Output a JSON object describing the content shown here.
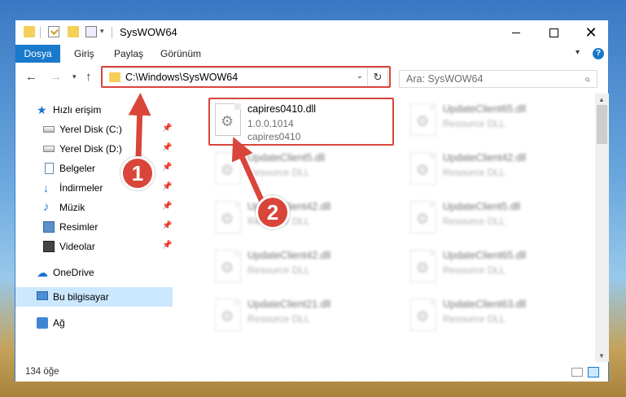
{
  "window": {
    "title": "SysWOW64",
    "minimize_icon": "minimize-icon",
    "maximize_icon": "maximize-icon",
    "close_label": "✕"
  },
  "ribbon": {
    "tabs": [
      {
        "label": "Dosya",
        "active": true
      },
      {
        "label": "Giriş"
      },
      {
        "label": "Paylaş"
      },
      {
        "label": "Görünüm"
      }
    ],
    "help_label": "?"
  },
  "nav": {
    "back_label": "←",
    "forward_label": "→",
    "recent_label": "▾",
    "up_label": "↑",
    "address": "C:\\Windows\\SysWOW64",
    "refresh_label": "↻",
    "search_placeholder": "Ara: SysWOW64",
    "search_label": "⌕"
  },
  "sidebar": {
    "items": [
      {
        "label": "Hızlı erişim",
        "icon": "star-icon"
      },
      {
        "label": "Yerel Disk (C:)",
        "icon": "disk-icon",
        "pinned": true
      },
      {
        "label": "Yerel Disk (D:)",
        "icon": "disk-icon",
        "pinned": true
      },
      {
        "label": "Belgeler",
        "icon": "document-icon",
        "pinned": true
      },
      {
        "label": "İndirmeler",
        "icon": "download-icon",
        "pinned": true
      },
      {
        "label": "Müzik",
        "icon": "music-icon",
        "pinned": true
      },
      {
        "label": "Resimler",
        "icon": "pictures-icon",
        "pinned": true
      },
      {
        "label": "Videolar",
        "icon": "video-icon",
        "pinned": true
      },
      {
        "label": "OneDrive",
        "icon": "cloud-icon"
      },
      {
        "label": "Bu bilgisayar",
        "icon": "computer-icon",
        "selected": true
      },
      {
        "label": "Ağ",
        "icon": "network-icon"
      }
    ],
    "pin_label": "📌"
  },
  "files": [
    {
      "name": "capires0410.dll",
      "line2": "1.0.0.1014",
      "line3": "capires0410",
      "highlighted": true
    },
    {
      "name": "UpdateClient65.dll",
      "line2": "Resource DLL",
      "line3": ""
    },
    {
      "name": "UpdateClient5.dll",
      "line2": "Resource DLL",
      "line3": ""
    },
    {
      "name": "UpdateClient42.dll",
      "line2": "Resource DLL",
      "line3": ""
    },
    {
      "name": "UpdateClient42.dll",
      "line2": "Resource DLL",
      "line3": ""
    },
    {
      "name": "UpdateClient5.dll",
      "line2": "Resource DLL",
      "line3": ""
    },
    {
      "name": "UpdateClient42.dll",
      "line2": "Resource DLL",
      "line3": ""
    },
    {
      "name": "UpdateClient65.dll",
      "line2": "Resource DLL",
      "line3": ""
    },
    {
      "name": "UpdateClient21.dll",
      "line2": "Resource DLL",
      "line3": ""
    },
    {
      "name": "UpdateClient63.dll",
      "line2": "Resource DLL",
      "line3": ""
    }
  ],
  "status": {
    "count": "134 öğe"
  },
  "callouts": {
    "one": "1",
    "two": "2",
    "color": "#d9453a"
  }
}
